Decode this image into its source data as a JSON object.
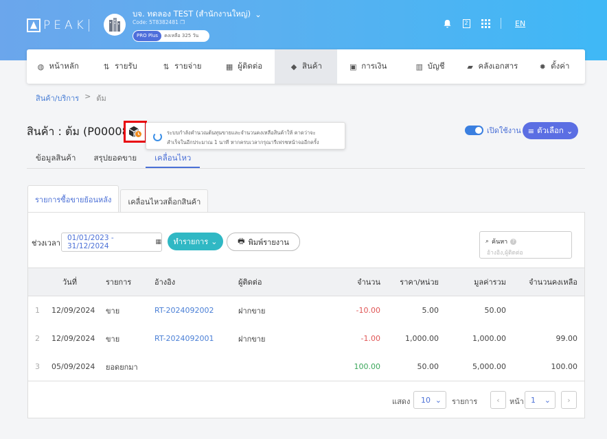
{
  "header": {
    "logo_text": "PEAK",
    "company_name": "บจ. ทดลอง TEST (สำนักงานใหญ่)",
    "company_code": "Code: 5T8382481",
    "plan": "PRO Plus",
    "days_left": "คงเหลือ 325 วัน",
    "notification_badge": "2",
    "language": "EN"
  },
  "nav": {
    "items": [
      {
        "label": "หน้าหลัก",
        "icon": "dashboard-icon",
        "glyph": "◍"
      },
      {
        "label": "รายรับ",
        "icon": "income-icon",
        "glyph": "⇅"
      },
      {
        "label": "รายจ่าย",
        "icon": "expense-icon",
        "glyph": "⇅"
      },
      {
        "label": "ผู้ติดต่อ",
        "icon": "contacts-icon",
        "glyph": "▦"
      },
      {
        "label": "สินค้า",
        "icon": "product-box-icon",
        "glyph": "◆"
      },
      {
        "label": "การเงิน",
        "icon": "money-icon",
        "glyph": "▣"
      },
      {
        "label": "บัญชี",
        "icon": "ledger-icon",
        "glyph": "▥"
      },
      {
        "label": "คลังเอกสาร",
        "icon": "folder-icon",
        "glyph": "▰"
      },
      {
        "label": "ตั้งค่า",
        "icon": "gear-icon",
        "glyph": "✹"
      }
    ]
  },
  "breadcrumb": {
    "parent": "สินค้า/บริการ",
    "sep": ">",
    "current": "ต้ม"
  },
  "page": {
    "title": "สินค้า : ต้ม (P00008",
    "tooltip_line1": "ระบบกำลังคำนวณต้นทุนขายและจำนวนคงเหลือสินค้าให้ คาดว่าจะ",
    "tooltip_line2": "สำเร็จในอีกประมาณ 1 นาที หากครบเวลากรุณารีเฟรชหน้าจออีกครั้ง",
    "toggle_label": "เปิดใช้งาน",
    "options_label": "ตัวเลือก"
  },
  "subtabs": [
    "ข้อมูลสินค้า",
    "สรุปยอดขาย",
    "เคลื่อนไหว"
  ],
  "cardtabs": [
    "รายการซื้อขายย้อนหลัง",
    "เคลื่อนไหวสต็อกสินค้า"
  ],
  "filter": {
    "label": "ช่วงเวลา",
    "date_range": "01/01/2023 - 31/12/2024",
    "doc_button": "ทำรายการ",
    "print_button": "พิมพ์รายงาน",
    "search_label": "ค้นหา",
    "search_placeholder": "อ้างอิง,ผู้ติดต่อ"
  },
  "table": {
    "headers": {
      "date": "วันที่",
      "type": "รายการ",
      "ref": "อ้างอิง",
      "contact": "ผู้ติดต่อ",
      "qty": "จำนวน",
      "price": "ราคา/หน่วย",
      "total": "มูลค่ารวม",
      "balance": "จำนวนคงเหลือ"
    },
    "rows": [
      {
        "idx": "1",
        "date": "12/09/2024",
        "type": "ขาย",
        "ref": "RT-2024092002",
        "contact": "ฝากขาย",
        "qty": "-10.00",
        "price": "5.00",
        "total": "50.00",
        "balance": ""
      },
      {
        "idx": "2",
        "date": "12/09/2024",
        "type": "ขาย",
        "ref": "RT-2024092001",
        "contact": "ฝากขาย",
        "qty": "-1.00",
        "price": "1,000.00",
        "total": "1,000.00",
        "balance": "99.00"
      },
      {
        "idx": "3",
        "date": "05/09/2024",
        "type": "ยอดยกมา",
        "ref": "",
        "contact": "",
        "qty": "100.00",
        "price": "50.00",
        "total": "5,000.00",
        "balance": "100.00"
      }
    ]
  },
  "pagination": {
    "show_label": "แสดง",
    "page_size": "10",
    "items_label": "รายการ",
    "page_label": "หน้า",
    "page": "1"
  }
}
